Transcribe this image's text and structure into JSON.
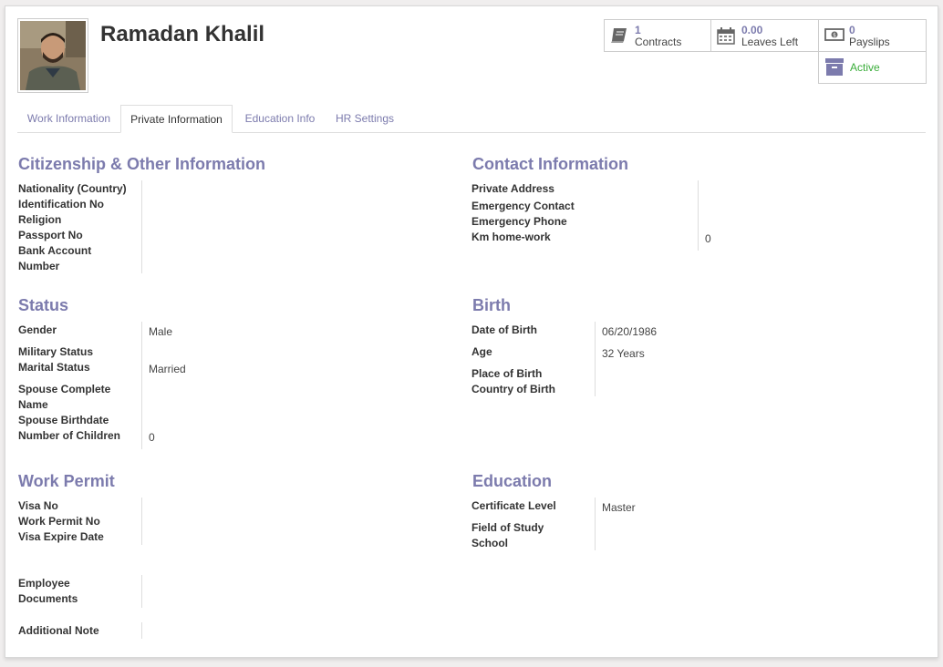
{
  "employee": {
    "name": "Ramadan Khalil"
  },
  "smart_buttons": {
    "contracts": {
      "value": "1",
      "label": "Contracts",
      "icon": "book-icon"
    },
    "leaves": {
      "value": "0.00",
      "label": "Leaves Left",
      "icon": "calendar-icon"
    },
    "payslips": {
      "value": "0",
      "label": "Payslips",
      "icon": "money-icon"
    },
    "active": {
      "label": "Active",
      "icon": "archive-icon",
      "color": "#3aad3a"
    }
  },
  "tabs": [
    {
      "label": "Work Information"
    },
    {
      "label": "Private Information"
    },
    {
      "label": "Education Info"
    },
    {
      "label": "HR Settings"
    }
  ],
  "citizenship": {
    "title": "Citizenship & Other Information",
    "labels": [
      "Nationality (Country)",
      "Identification No",
      "Religion",
      "Passport No",
      "Bank Account",
      "Number"
    ]
  },
  "contact": {
    "title": "Contact Information",
    "labels": [
      "Private Address",
      "Emergency Contact",
      "Emergency Phone",
      "Km home-work"
    ],
    "km_value": "0"
  },
  "status": {
    "title": "Status",
    "gender_label": "Gender",
    "gender_value": "Male",
    "military_label": "Military Status",
    "marital_label": "Marital Status",
    "marital_value": "Married",
    "spouse_name_label_1": "Spouse Complete",
    "spouse_name_label_2": "Name",
    "spouse_birthdate_label": "Spouse Birthdate",
    "children_label": "Number of Children",
    "children_value": "0"
  },
  "birth": {
    "title": "Birth",
    "dob_label": "Date of Birth",
    "dob_value": "06/20/1986",
    "age_label": "Age",
    "age_value": "32 Years",
    "place_label": "Place of Birth",
    "country_label": "Country of Birth"
  },
  "work_permit": {
    "title": "Work Permit",
    "labels": [
      "Visa No",
      "Work Permit No",
      "Visa Expire Date"
    ]
  },
  "education": {
    "title": "Education",
    "cert_label": "Certificate Level",
    "cert_value": "Master",
    "field_label": "Field of Study",
    "school_label": "School"
  },
  "documents": {
    "label_1": "Employee",
    "label_2": "Documents"
  },
  "note": {
    "label": "Additional Note"
  },
  "colors": {
    "accent": "#7c7bad",
    "active": "#3aad3a"
  }
}
